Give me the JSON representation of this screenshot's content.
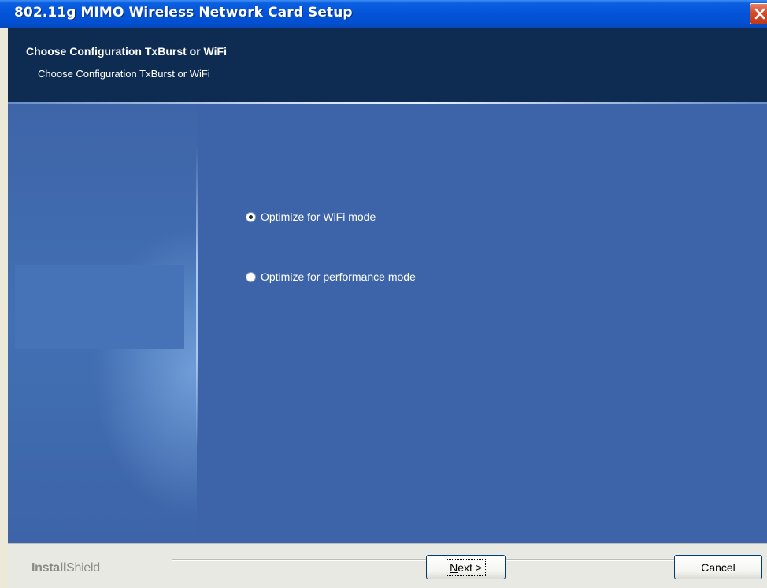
{
  "window": {
    "title": "802.11g MIMO Wireless Network Card Setup",
    "close_icon": "close-icon"
  },
  "header": {
    "title": "Choose Configuration TxBurst or WiFi",
    "subtitle": "Choose Configuration TxBurst or WiFi"
  },
  "options": [
    {
      "label": "Optimize for WiFi mode",
      "selected": true
    },
    {
      "label": "Optimize for performance mode",
      "selected": false
    }
  ],
  "footer": {
    "brand_bold": "Install",
    "brand_thin": "Shield",
    "next_label_accel": "N",
    "next_label_rest": "ext >",
    "cancel_label": "Cancel"
  },
  "colors": {
    "titlebar": "#0353d8",
    "header_bg": "#0e2b52",
    "main_bg": "#3d64a8",
    "close_button": "#c1391b"
  }
}
